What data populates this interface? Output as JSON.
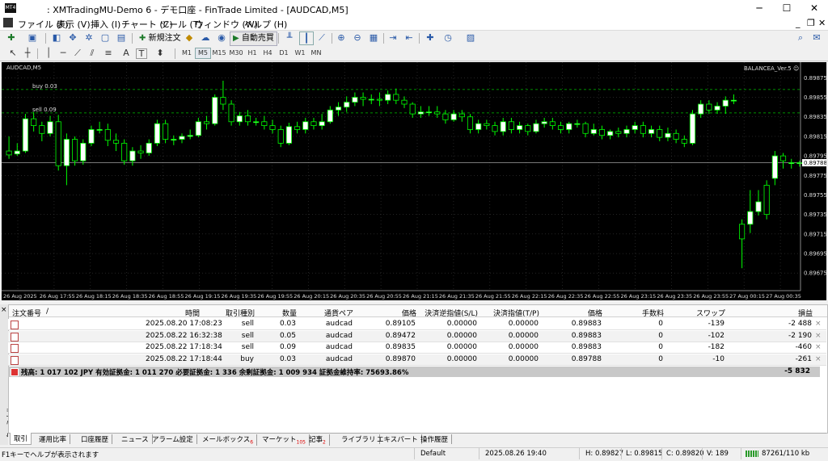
{
  "window": {
    "app_icon_text": "MT4",
    "title": ": XMTradingMU-Demo 6 - デモ口座 - FinTrade Limited - [AUDCAD,M5]",
    "minimize": "─",
    "maximize": "☐",
    "close": "✕"
  },
  "menu": {
    "items": [
      "ファイル (F)",
      "表示 (V)",
      "挿入 (I)",
      "チャート (C)",
      "ツール (T)",
      "ウィンドウ (W)",
      "ヘルプ (H)"
    ],
    "mdi_minimize": "_",
    "mdi_restore": "❐",
    "mdi_close": "✕"
  },
  "toolbar": {
    "new_order_label": "新規注文",
    "auto_trade_label": "自動売買",
    "timeframes": [
      "M1",
      "M5",
      "M15",
      "M30",
      "H1",
      "H4",
      "D1",
      "W1",
      "MN"
    ],
    "active_timeframe": "M5",
    "text_tool": "A",
    "label_tool": "T"
  },
  "chart": {
    "symbol_label": "AUDCAD,M5",
    "ea_label": "BALANCEA_Ver.5 ☺",
    "buy_line_label": "buy 0.03",
    "sell_line_label": "sell 0.09",
    "current_price_label": "0.89788",
    "colors": {
      "background": "#000000",
      "bull": "#ffffff",
      "bear": "#000000",
      "candle_outline": "#00ff00",
      "grid": "#3a3a3a",
      "order_line": "#00c000",
      "bid_line": "#c0c0c0"
    }
  },
  "chart_data": {
    "type": "candlestick",
    "symbol": "AUDCAD",
    "timeframe": "M5",
    "ylim": [
      0.89657,
      0.89891
    ],
    "y_ticks": [
      "0.89875",
      "0.89855",
      "0.89835",
      "0.89815",
      "0.89795",
      "0.89775",
      "0.89755",
      "0.89735",
      "0.89715",
      "0.89695",
      "0.89675"
    ],
    "x_ticks": [
      "26 Aug 2025",
      "26 Aug 17:55",
      "26 Aug 18:15",
      "26 Aug 18:35",
      "26 Aug 18:55",
      "26 Aug 19:15",
      "26 Aug 19:35",
      "26 Aug 19:55",
      "26 Aug 20:15",
      "26 Aug 20:35",
      "26 Aug 20:55",
      "26 Aug 21:15",
      "26 Aug 21:35",
      "26 Aug 21:55",
      "26 Aug 22:15",
      "26 Aug 22:35",
      "26 Aug 22:55",
      "26 Aug 23:15",
      "26 Aug 23:35",
      "26 Aug 23:55",
      "27 Aug 00:15",
      "27 Aug 00:35"
    ],
    "buy_line_price": 0.89863,
    "sell_line_price": 0.89839,
    "bid_price": 0.89788,
    "candles": [
      [
        0.898,
        0.89796,
        0.89815,
        0.89792
      ],
      [
        0.89797,
        0.898,
        0.89808,
        0.89795
      ],
      [
        0.898,
        0.89833,
        0.89838,
        0.89798
      ],
      [
        0.89833,
        0.89826,
        0.8984,
        0.8982
      ],
      [
        0.89826,
        0.89818,
        0.8983,
        0.8981
      ],
      [
        0.89818,
        0.8983,
        0.89836,
        0.89815
      ],
      [
        0.8983,
        0.89785,
        0.89837,
        0.8978
      ],
      [
        0.89785,
        0.89812,
        0.89818,
        0.89765
      ],
      [
        0.89812,
        0.8979,
        0.89815,
        0.89785
      ],
      [
        0.8979,
        0.89808,
        0.89812,
        0.89786
      ],
      [
        0.89808,
        0.89822,
        0.89826,
        0.89805
      ],
      [
        0.89822,
        0.89822,
        0.8983,
        0.89818
      ],
      [
        0.89822,
        0.89811,
        0.89828,
        0.89805
      ],
      [
        0.89811,
        0.89808,
        0.89818,
        0.898
      ],
      [
        0.89808,
        0.8979,
        0.89812,
        0.89786
      ],
      [
        0.8979,
        0.898,
        0.89804,
        0.89785
      ],
      [
        0.898,
        0.89798,
        0.89806,
        0.89792
      ],
      [
        0.89798,
        0.89808,
        0.89812,
        0.89795
      ],
      [
        0.89808,
        0.89828,
        0.89832,
        0.89805
      ],
      [
        0.89828,
        0.89812,
        0.89832,
        0.89808
      ],
      [
        0.89812,
        0.89812,
        0.89816,
        0.89806
      ],
      [
        0.89812,
        0.89815,
        0.89818,
        0.89808
      ],
      [
        0.89815,
        0.89816,
        0.89822,
        0.89812
      ],
      [
        0.89816,
        0.8983,
        0.89834,
        0.89814
      ],
      [
        0.8983,
        0.89828,
        0.89836,
        0.89822
      ],
      [
        0.89828,
        0.89855,
        0.89858,
        0.89826
      ],
      [
        0.89855,
        0.89848,
        0.89872,
        0.89842
      ],
      [
        0.89848,
        0.8983,
        0.89852,
        0.89826
      ],
      [
        0.8983,
        0.89836,
        0.8984,
        0.89826
      ],
      [
        0.89836,
        0.8983,
        0.89842,
        0.89826
      ],
      [
        0.8983,
        0.8983,
        0.89834,
        0.89826
      ],
      [
        0.8983,
        0.89826,
        0.89836,
        0.89822
      ],
      [
        0.89826,
        0.89822,
        0.89832,
        0.89818
      ],
      [
        0.89822,
        0.89808,
        0.89826,
        0.89804
      ],
      [
        0.89808,
        0.89825,
        0.89829,
        0.89806
      ],
      [
        0.89825,
        0.89822,
        0.8983,
        0.89818
      ],
      [
        0.89822,
        0.8983,
        0.89834,
        0.89818
      ],
      [
        0.8983,
        0.89826,
        0.89834,
        0.89822
      ],
      [
        0.89826,
        0.8983,
        0.89838,
        0.89822
      ],
      [
        0.8983,
        0.89842,
        0.89846,
        0.89828
      ],
      [
        0.89842,
        0.89845,
        0.8985,
        0.89836
      ],
      [
        0.89845,
        0.8985,
        0.89856,
        0.8984
      ],
      [
        0.8985,
        0.89855,
        0.8986,
        0.89846
      ],
      [
        0.89855,
        0.89853,
        0.8986,
        0.89846
      ],
      [
        0.89853,
        0.89853,
        0.89858,
        0.89848
      ],
      [
        0.89853,
        0.89852,
        0.8986,
        0.89846
      ],
      [
        0.89852,
        0.89858,
        0.89862,
        0.89848
      ],
      [
        0.89858,
        0.89852,
        0.89864,
        0.89848
      ],
      [
        0.89852,
        0.89848,
        0.89856,
        0.89844
      ],
      [
        0.89848,
        0.89838,
        0.8985,
        0.89834
      ],
      [
        0.89838,
        0.8984,
        0.89846,
        0.89834
      ],
      [
        0.8984,
        0.8984,
        0.89846,
        0.89836
      ],
      [
        0.8984,
        0.89838,
        0.89846,
        0.89834
      ],
      [
        0.89838,
        0.89832,
        0.89842,
        0.89828
      ],
      [
        0.89832,
        0.89838,
        0.89842,
        0.8983
      ],
      [
        0.89838,
        0.89835,
        0.89842,
        0.8983
      ],
      [
        0.89835,
        0.89822,
        0.89838,
        0.89818
      ],
      [
        0.89822,
        0.89828,
        0.89832,
        0.89818
      ],
      [
        0.89828,
        0.89826,
        0.89832,
        0.89822
      ],
      [
        0.89826,
        0.8982,
        0.8983,
        0.89816
      ],
      [
        0.8982,
        0.8983,
        0.89834,
        0.89816
      ],
      [
        0.8983,
        0.89822,
        0.89834,
        0.89818
      ],
      [
        0.89822,
        0.89826,
        0.8983,
        0.89818
      ],
      [
        0.89826,
        0.8982,
        0.89828,
        0.89816
      ],
      [
        0.8982,
        0.89828,
        0.89832,
        0.89818
      ],
      [
        0.89828,
        0.8983,
        0.89834,
        0.89824
      ],
      [
        0.8983,
        0.89826,
        0.89834,
        0.89822
      ],
      [
        0.89826,
        0.89822,
        0.8983,
        0.89818
      ],
      [
        0.89822,
        0.89828,
        0.8983,
        0.89818
      ],
      [
        0.89828,
        0.89828,
        0.89832,
        0.89824
      ],
      [
        0.89828,
        0.89818,
        0.8983,
        0.89814
      ],
      [
        0.89818,
        0.89822,
        0.89828,
        0.89816
      ],
      [
        0.89822,
        0.89816,
        0.89826,
        0.89812
      ],
      [
        0.89816,
        0.8982,
        0.89822,
        0.89812
      ],
      [
        0.8982,
        0.89818,
        0.89824,
        0.89814
      ],
      [
        0.89818,
        0.89822,
        0.89826,
        0.89814
      ],
      [
        0.89822,
        0.89826,
        0.8983,
        0.89818
      ],
      [
        0.89826,
        0.89818,
        0.8983,
        0.89814
      ],
      [
        0.89818,
        0.89822,
        0.89826,
        0.89814
      ],
      [
        0.89822,
        0.89814,
        0.89826,
        0.8981
      ],
      [
        0.89814,
        0.89818,
        0.89824,
        0.8981
      ],
      [
        0.89818,
        0.89812,
        0.89822,
        0.89808
      ],
      [
        0.89812,
        0.89808,
        0.89816,
        0.89804
      ],
      [
        0.89808,
        0.89838,
        0.89842,
        0.89806
      ],
      [
        0.89838,
        0.89848,
        0.89852,
        0.89834
      ],
      [
        0.89848,
        0.89842,
        0.89852,
        0.89838
      ],
      [
        0.89842,
        0.89846,
        0.8985,
        0.89838
      ],
      [
        0.89846,
        0.89852,
        0.89856,
        0.89838
      ],
      [
        0.89852,
        0.89852,
        0.89858,
        0.89848
      ],
      [
        0.89725,
        0.8971,
        0.8973,
        0.8968
      ],
      [
        0.89725,
        0.89738,
        0.8976,
        0.89716
      ],
      [
        0.89738,
        0.89748,
        0.8976,
        0.89734
      ],
      [
        0.89765,
        0.89735,
        0.8977,
        0.8973
      ],
      [
        0.89772,
        0.89795,
        0.898,
        0.89765
      ],
      [
        0.89795,
        0.8979,
        0.89798,
        0.89782
      ],
      [
        0.89788,
        0.89788,
        0.89792,
        0.89782
      ],
      [
        0.89788,
        0.89788,
        0.8979,
        0.89784
      ]
    ]
  },
  "terminal": {
    "headers": {
      "order": "注文番号",
      "sort": "/",
      "time": "時間",
      "type": "取引種別",
      "size": "数量",
      "symbol": "通貨ペア",
      "price": "価格",
      "sl": "決済逆指値(S/L)",
      "tp": "決済指値(T/P)",
      "cur_price": "価格",
      "commission": "手数料",
      "swap": "スワップ",
      "profit": "損益"
    },
    "rows": [
      {
        "time": "2025.08.20 17:08:23",
        "type": "sell",
        "size": "0.03",
        "symbol": "audcad",
        "price": "0.89105",
        "sl": "0.00000",
        "tp": "0.00000",
        "cur_price": "0.89883",
        "commission": "0",
        "swap": "-139",
        "profit": "-2 488",
        "close": "×"
      },
      {
        "time": "2025.08.22 16:32:38",
        "type": "sell",
        "size": "0.05",
        "symbol": "audcad",
        "price": "0.89472",
        "sl": "0.00000",
        "tp": "0.00000",
        "cur_price": "0.89883",
        "commission": "0",
        "swap": "-102",
        "profit": "-2 190",
        "close": "×"
      },
      {
        "time": "2025.08.22 17:18:34",
        "type": "sell",
        "size": "0.09",
        "symbol": "audcad",
        "price": "0.89835",
        "sl": "0.00000",
        "tp": "0.00000",
        "cur_price": "0.89883",
        "commission": "0",
        "swap": "-182",
        "profit": "-460",
        "close": "×"
      },
      {
        "time": "2025.08.22 17:18:44",
        "type": "buy",
        "size": "0.03",
        "symbol": "audcad",
        "price": "0.89870",
        "sl": "0.00000",
        "tp": "0.00000",
        "cur_price": "0.89788",
        "commission": "0",
        "swap": "-10",
        "profit": "-261",
        "close": "×"
      }
    ],
    "summary": "残高: 1 017 102 JPY  有効証拠金: 1 011 270  必要証拠金: 1 336  余剰証拠金: 1 009 934  証拠金維持率: 75693.86%",
    "summary_profit": "-5 832",
    "side_label": "ターミナル",
    "close_x": "×"
  },
  "tabs": [
    {
      "label": "取引",
      "badge": ""
    },
    {
      "label": "運用比率",
      "badge": ""
    },
    {
      "label": "口座履歴",
      "badge": ""
    },
    {
      "label": "ニュース",
      "badge": ""
    },
    {
      "label": "アラーム設定",
      "badge": ""
    },
    {
      "label": "メールボックス",
      "badge": "6"
    },
    {
      "label": "マーケット",
      "badge": "105"
    },
    {
      "label": "記事",
      "badge": "2"
    },
    {
      "label": "ライブラリ",
      "badge": ""
    },
    {
      "label": "エキスパート",
      "badge": ""
    },
    {
      "label": "操作履歴",
      "badge": ""
    }
  ],
  "status": {
    "help": "F1キーでヘルプが表示されます",
    "profile": "Default",
    "datetime": "2025.08.26 19:40",
    "high": "H: 0.89827",
    "low": "L: 0.89815",
    "close": "C: 0.89820",
    "volume": "V: 189",
    "traffic": "87261/110 kb"
  }
}
